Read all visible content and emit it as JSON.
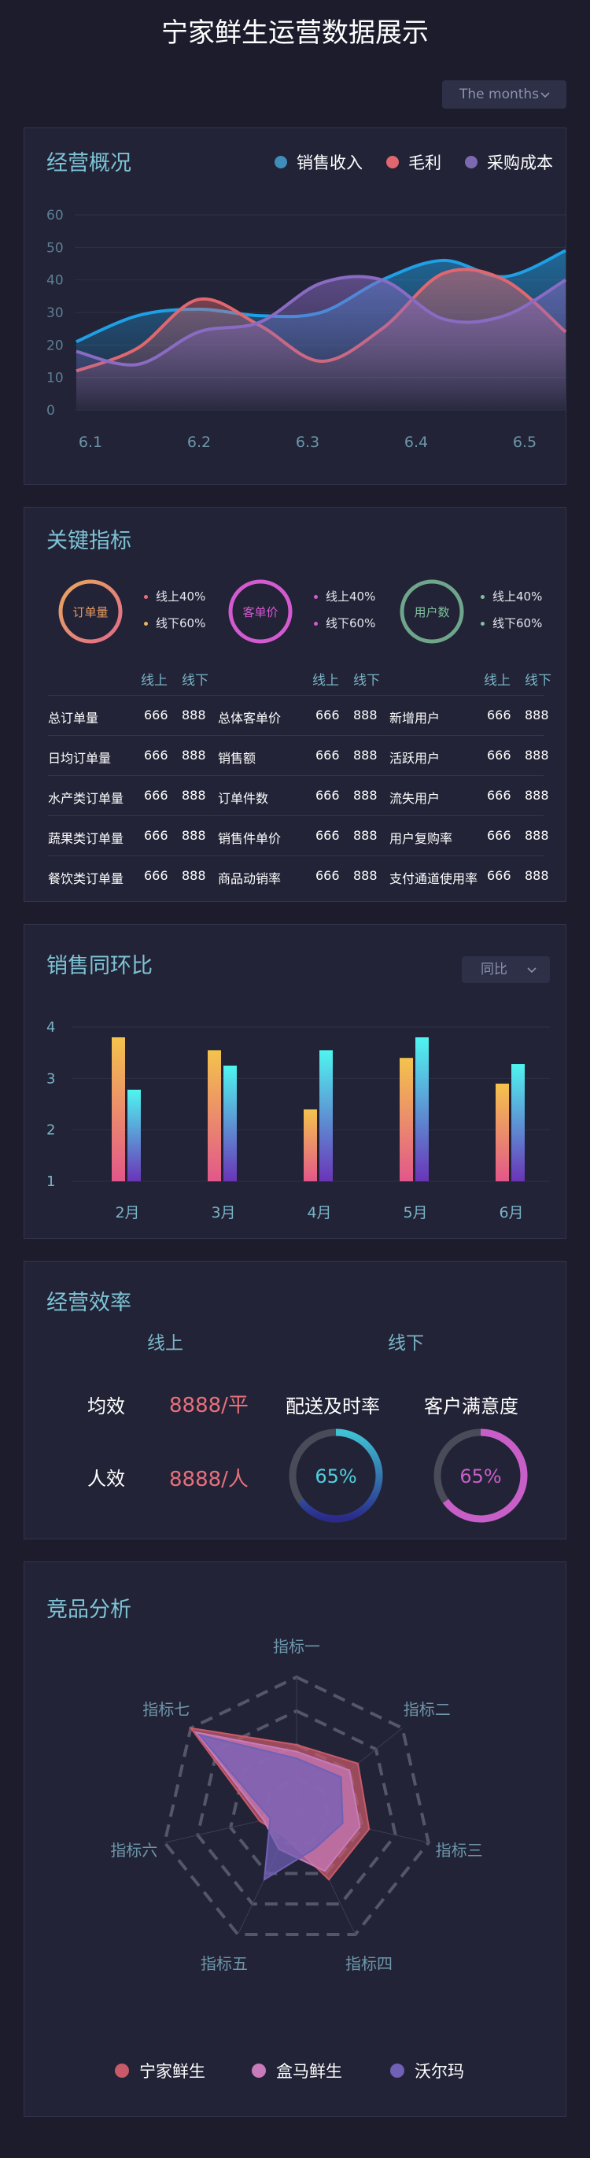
{
  "page_title": "宁家鲜生运营数据展示",
  "months_dropdown": "The months",
  "overview": {
    "title": "经营概况",
    "legend": [
      {
        "name": "销售收入",
        "color": "#3f8db9"
      },
      {
        "name": "毛利",
        "color": "#e0676f"
      },
      {
        "name": "采购成本",
        "color": "#7c69b2"
      }
    ]
  },
  "key_metrics": {
    "title": "关键指标",
    "rings": [
      {
        "label": "订单量",
        "color_a": "#e8a85c",
        "color_b": "#e36b8b",
        "text_color": "#e89c62",
        "legend": [
          "线上40%",
          "线下60%"
        ],
        "bullets": [
          "#e8707d",
          "#e8b45c"
        ]
      },
      {
        "label": "客单价",
        "color_a": "#d35ad0",
        "color_b": "#d35ad0",
        "text_color": "#d35ad0",
        "legend": [
          "线上40%",
          "线下60%"
        ],
        "bullets": [
          "#d35ad0",
          "#d35ad0"
        ]
      },
      {
        "label": "用户数",
        "color_a": "#6fa68b",
        "color_b": "#6fa68b",
        "text_color": "#7fc09e",
        "legend": [
          "线上40%",
          "线下60%"
        ],
        "bullets": [
          "#7fc09e",
          "#7fc09e"
        ]
      }
    ],
    "headers": [
      "线上",
      "线下"
    ],
    "rows": [
      [
        {
          "name": "总订单量",
          "on": "666",
          "off": "888"
        },
        {
          "name": "总体客单价",
          "on": "666",
          "off": "888"
        },
        {
          "name": "新增用户",
          "on": "666",
          "off": "888"
        }
      ],
      [
        {
          "name": "日均订单量",
          "on": "666",
          "off": "888"
        },
        {
          "name": "销售额",
          "on": "666",
          "off": "888"
        },
        {
          "name": "活跃用户",
          "on": "666",
          "off": "888"
        }
      ],
      [
        {
          "name": "水产类订单量",
          "on": "666",
          "off": "888"
        },
        {
          "name": "订单件数",
          "on": "666",
          "off": "888"
        },
        {
          "name": "流失用户",
          "on": "666",
          "off": "888"
        }
      ],
      [
        {
          "name": "蔬果类订单量",
          "on": "666",
          "off": "888"
        },
        {
          "name": "销售件单价",
          "on": "666",
          "off": "888"
        },
        {
          "name": "用户复购率",
          "on": "666",
          "off": "888"
        }
      ],
      [
        {
          "name": "餐饮类订单量",
          "on": "666",
          "off": "888"
        },
        {
          "name": "商品动销率",
          "on": "666",
          "off": "888"
        },
        {
          "name": "支付通道使用率",
          "on": "666",
          "off": "888"
        }
      ]
    ]
  },
  "sales": {
    "title": "销售同环比",
    "dropdown": "同比"
  },
  "efficiency": {
    "title": "经营效率",
    "tabs": [
      "线上",
      "线下"
    ],
    "rows": [
      {
        "label": "均效",
        "value": "8888/平"
      },
      {
        "label": "人效",
        "value": "8888/人"
      }
    ],
    "gauges": [
      {
        "label": "配送及时率",
        "percent": 65,
        "text": "65%",
        "color": "#3fc3d4",
        "color2": "#2a2a8a",
        "text_color": "#4fd0de"
      },
      {
        "label": "客户满意度",
        "percent": 65,
        "text": "65%",
        "color": "#c85fc8",
        "color2": "#c85fc8",
        "text_color": "#c85fc8"
      }
    ]
  },
  "competitors": {
    "title": "竞品分析"
  },
  "chart_data": [
    {
      "type": "area",
      "x": [
        "6.1",
        "6.2",
        "6.3",
        "6.4",
        "6.5"
      ],
      "ylim": [
        0,
        60
      ],
      "yticks": [
        0,
        10,
        20,
        30,
        40,
        50,
        60
      ],
      "grid": true,
      "series": [
        {
          "name": "销售收入",
          "color": "#1e9fe6",
          "values": [
            21,
            31,
            30,
            46,
            49
          ]
        },
        {
          "name": "毛利",
          "color": "#e0676f",
          "values": [
            12,
            34,
            15,
            42,
            24
          ]
        },
        {
          "name": "采购成本",
          "color": "#8a6bc4",
          "values": [
            18,
            24,
            39,
            28,
            40
          ]
        }
      ],
      "curve_points_x": [
        0,
        0.125,
        0.25,
        0.375,
        0.5,
        0.625,
        0.75,
        0.875,
        1
      ],
      "curve_series": [
        [
          21,
          29,
          31,
          29,
          30,
          40,
          46,
          41,
          49
        ],
        [
          12,
          19,
          34,
          26,
          15,
          25,
          42,
          40,
          24
        ],
        [
          18,
          14,
          24,
          27,
          39,
          40,
          28,
          29,
          40
        ]
      ]
    },
    {
      "type": "bar",
      "categories": [
        "2月",
        "3月",
        "4月",
        "5月",
        "6月"
      ],
      "ylim": [
        1,
        4
      ],
      "yticks": [
        1,
        2,
        3,
        4
      ],
      "series": [
        {
          "values": [
            3.8,
            3.55,
            2.4,
            3.4,
            2.9
          ],
          "color_top": "#f4c34c",
          "color_bottom": "#e2578a"
        },
        {
          "values": [
            2.78,
            3.25,
            3.55,
            3.8,
            3.28
          ],
          "color_top": "#4ff5f0",
          "color_bottom": "#6a34b8"
        }
      ]
    },
    {
      "type": "radar",
      "axes": [
        "指标一",
        "指标二",
        "指标三",
        "指标四",
        "指标五",
        "指标六",
        "指标七"
      ],
      "max": 100,
      "series": [
        {
          "name": "宁家鲜生",
          "color": "#c85a6a",
          "values": [
            50,
            58,
            55,
            55,
            20,
            28,
            100
          ]
        },
        {
          "name": "盒马鲜生",
          "color": "#c77bbb",
          "values": [
            45,
            50,
            48,
            48,
            30,
            25,
            95
          ]
        },
        {
          "name": "沃尔玛",
          "color": "#7060b6",
          "values": [
            40,
            42,
            35,
            30,
            55,
            20,
            92
          ]
        }
      ]
    }
  ]
}
